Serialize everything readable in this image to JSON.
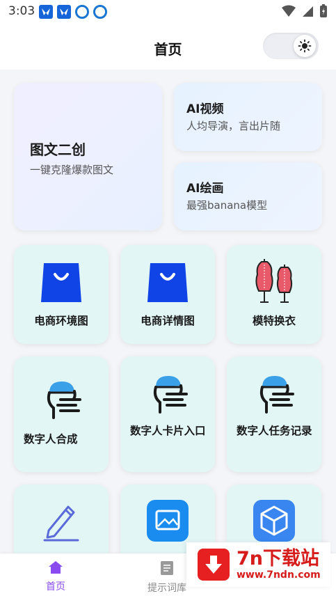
{
  "status": {
    "time": "3:03"
  },
  "header": {
    "title": "首页",
    "theme_toggle_icon": "sun-icon"
  },
  "features": {
    "big": {
      "title": "图文二创",
      "subtitle": "一键克隆爆款图文"
    },
    "video": {
      "title": "AI视频",
      "subtitle": "人均导演，言出片随"
    },
    "draw": {
      "title": "AI绘画",
      "subtitle": "最强banana模型"
    }
  },
  "tiles": [
    {
      "label": "电商环境图",
      "icon": "shopping-bag-icon"
    },
    {
      "label": "电商详情图",
      "icon": "shopping-bag-icon"
    },
    {
      "label": "模特换衣",
      "icon": "mannequin-icon"
    },
    {
      "label": "数字人合成",
      "icon": "digital-human-icon"
    },
    {
      "label": "数字人卡片入口",
      "icon": "digital-human-icon"
    },
    {
      "label": "数字人任务记录",
      "icon": "digital-human-icon"
    },
    {
      "label": "",
      "icon": "pencil-icon"
    },
    {
      "label": "",
      "icon": "image-icon"
    },
    {
      "label": "",
      "icon": "cube-icon"
    }
  ],
  "nav": {
    "home": "首页",
    "prompts": "提示词库"
  },
  "watermark": {
    "brand": "7n下载站",
    "url": "www.7ndn.com"
  },
  "colors": {
    "accent": "#8a4bf0",
    "tile_bg": "#e3f6f6",
    "bag_blue": "#1144e6",
    "watermark_red": "#d61b1b"
  }
}
